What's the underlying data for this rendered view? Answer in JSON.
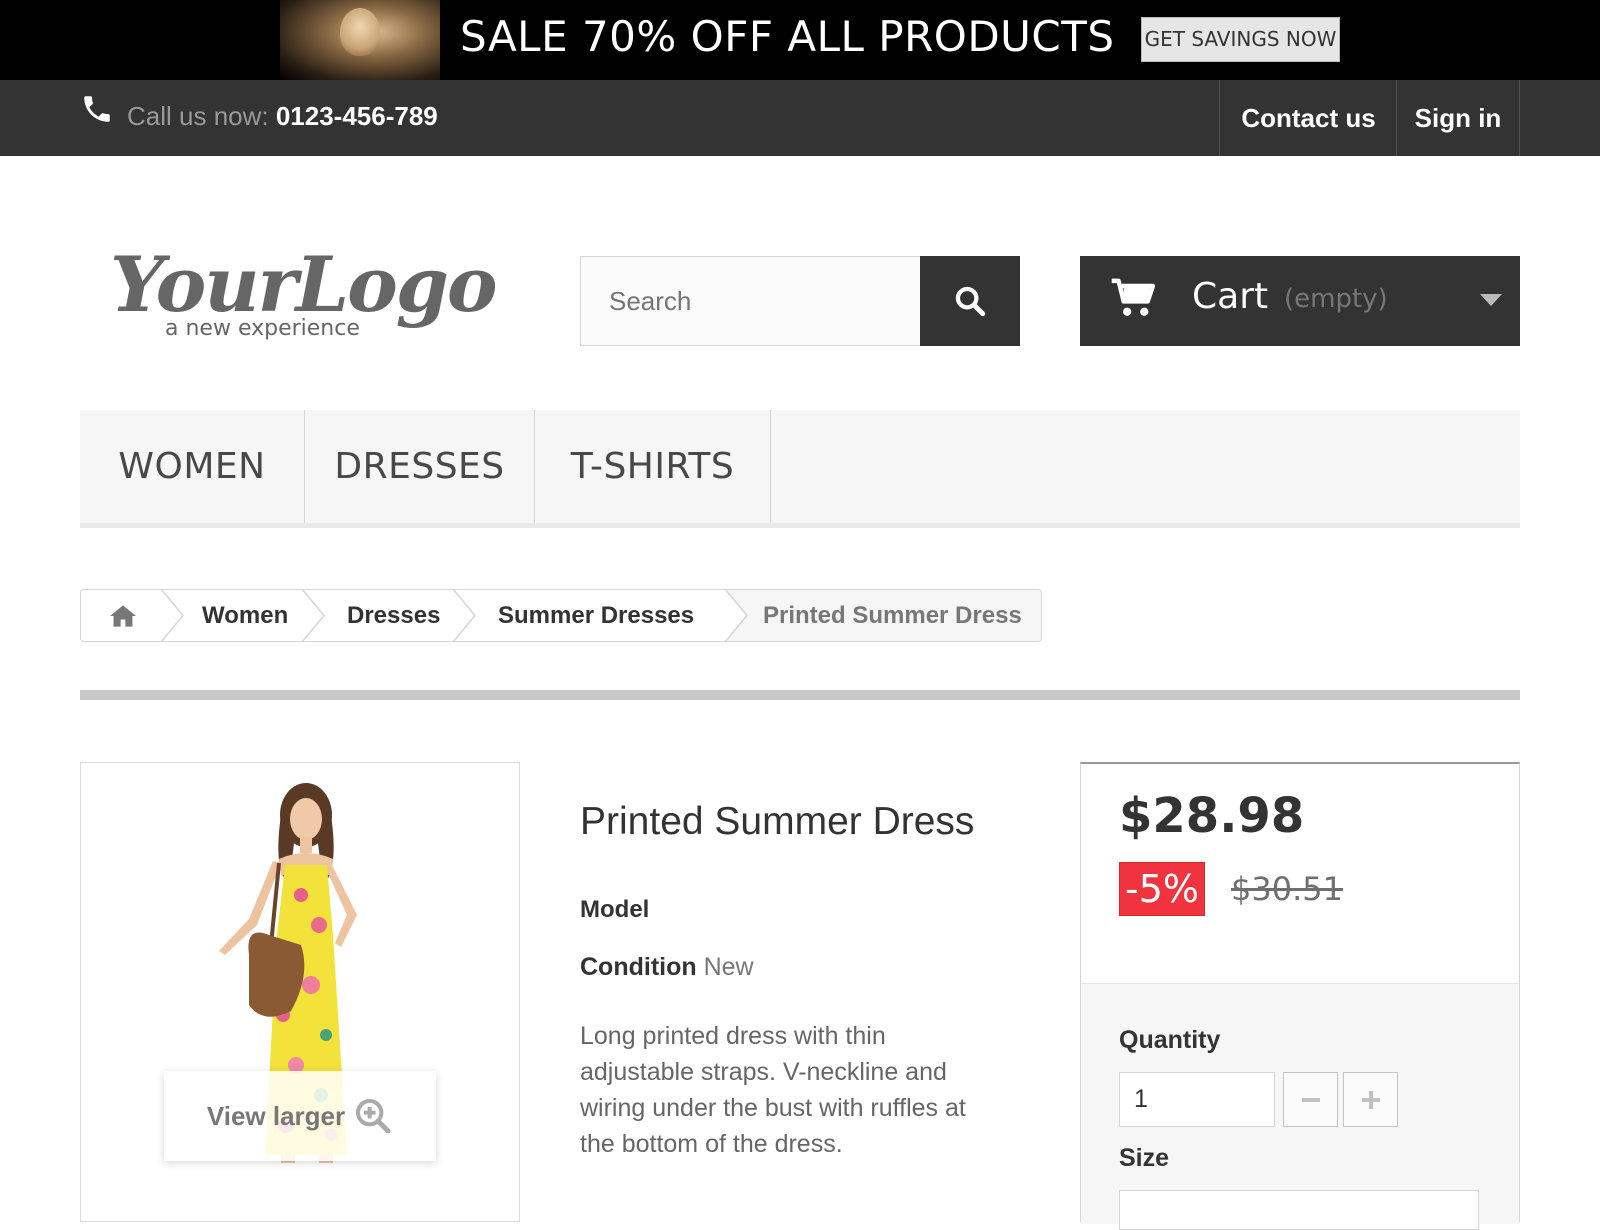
{
  "promo": {
    "headline": "SALE 70% OFF ALL PRODUCTS",
    "button_label": "GET SAVINGS NOW"
  },
  "topbar": {
    "call_label": "Call us now: ",
    "phone": "0123-456-789",
    "contact_label": "Contact us",
    "signin_label": "Sign in"
  },
  "header": {
    "logo_main": "YourLogo",
    "logo_tagline": "a new experience",
    "search_placeholder": "Search",
    "cart_label": "Cart",
    "cart_status": "(empty)"
  },
  "menu": {
    "items": [
      "WOMEN",
      "DRESSES",
      "T-SHIRTS"
    ]
  },
  "breadcrumb": {
    "items": [
      "Women",
      "Dresses",
      "Summer Dresses"
    ],
    "current": "Printed Summer Dress"
  },
  "product": {
    "title": "Printed Summer Dress",
    "model_label": "Model",
    "condition_label": "Condition",
    "condition_value": "New",
    "description": "Long printed dress with thin adjustable straps. V-neckline and wiring under the bust with ruffles at the bottom of the dress.",
    "view_larger_label": "View larger"
  },
  "pricing": {
    "price": "$28.98",
    "discount": "-5%",
    "old_price": "$30.51",
    "quantity_label": "Quantity",
    "quantity_value": "1",
    "size_label": "Size"
  },
  "colors": {
    "dark_bar": "#333333",
    "discount_red": "#f13340",
    "menu_bg": "#f6f6f6"
  },
  "icons": [
    "phone-icon",
    "search-icon",
    "cart-icon",
    "caret-down-icon",
    "home-icon",
    "zoom-in-icon",
    "minus-icon",
    "plus-icon"
  ]
}
